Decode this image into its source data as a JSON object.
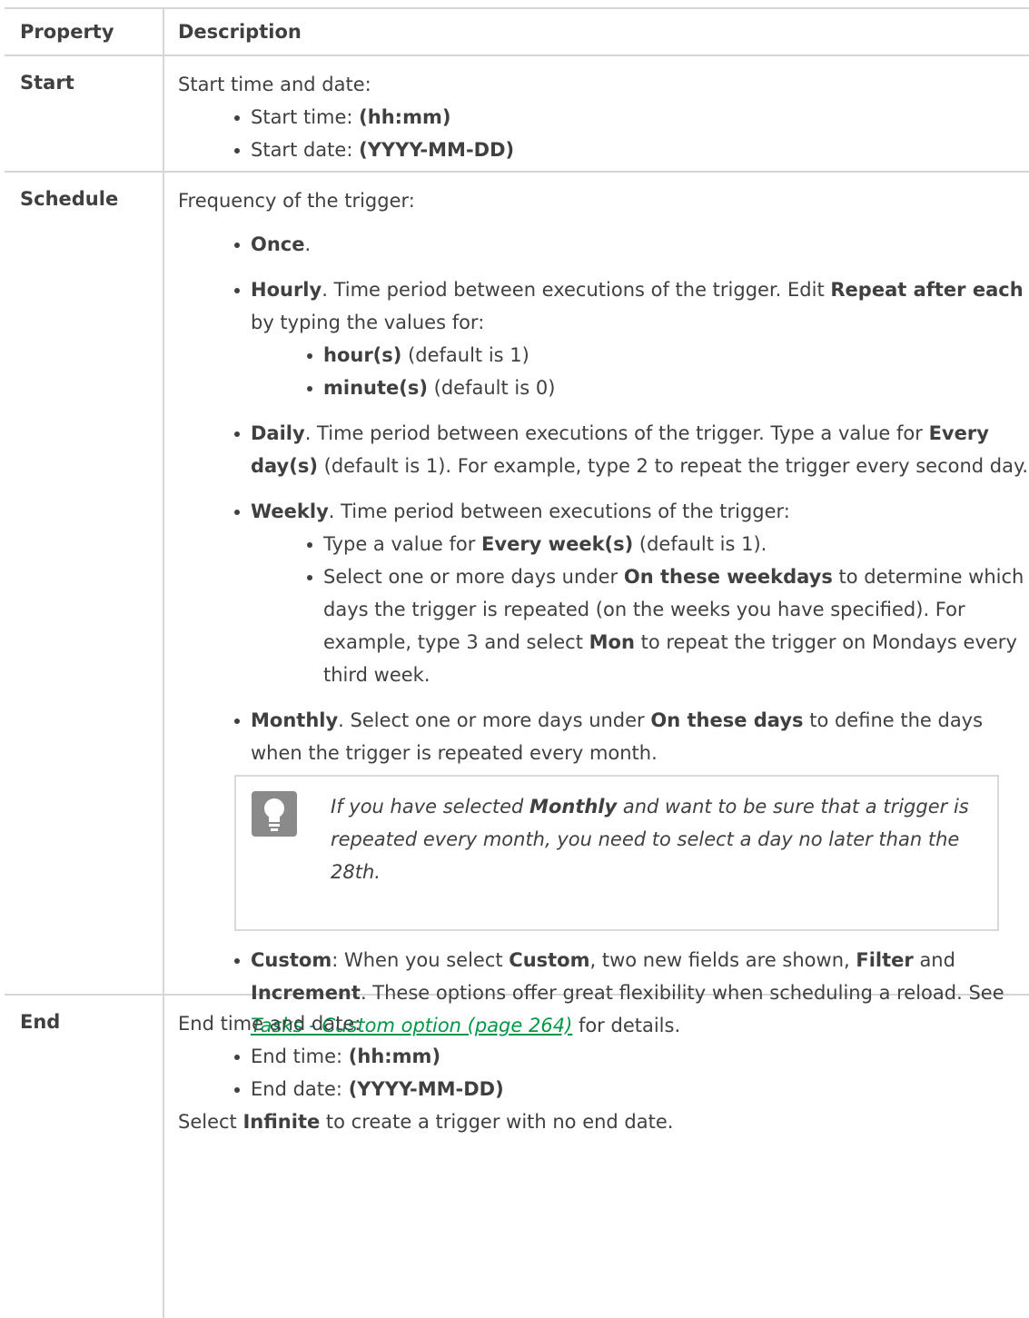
{
  "header": {
    "col1": "Property",
    "col2": "Description"
  },
  "start": {
    "name": "Start",
    "intro": "Start time and date:",
    "items": [
      {
        "label": "Start time: ",
        "value": "(hh:mm)"
      },
      {
        "label": "Start date: ",
        "value": "(YYYY-MM-DD)"
      }
    ]
  },
  "schedule": {
    "name": "Schedule",
    "intro": "Frequency of the trigger:",
    "once": {
      "title": "Once",
      "suffix": "."
    },
    "hourly": {
      "title": "Hourly",
      "text1": ". Time period between executions of the trigger. Edit ",
      "bold1": "Repeat after each",
      "text2": " by typing the values for:",
      "sub": [
        {
          "bold": "hour(s)",
          "text": " (default is 1)"
        },
        {
          "bold": "minute(s)",
          "text": " (default is 0)"
        }
      ]
    },
    "daily": {
      "title": "Daily",
      "text1": ". Time period between executions of the trigger. Type a value for ",
      "bold1": "Every day(s)",
      "text2": " (default is 1). For example, type 2 to repeat the trigger every second day."
    },
    "weekly": {
      "title": "Weekly",
      "text1": ". Time period between executions of the trigger:",
      "sub1": {
        "text1": "Type a value for ",
        "bold": "Every week(s)",
        "text2": " (default is 1)."
      },
      "sub2": {
        "text1": "Select one or more days under ",
        "bold1": "On these weekdays",
        "text2": " to determine which days the trigger is repeated (on the weeks you have specified). For example, type 3 and select ",
        "bold2": "Mon",
        "text3": " to repeat the trigger on Mondays every third week."
      }
    },
    "monthly": {
      "title": "Monthly",
      "text1": ". Select one or more days under ",
      "bold1": "On these days",
      "text2": " to define the days when the trigger is repeated every month."
    },
    "tip": {
      "text1": "If you have selected ",
      "bold": "Monthly",
      "text2": " and want to be sure that a trigger is repeated every month, you need to select a day no later than the 28th."
    },
    "custom": {
      "title": "Custom",
      "text1": ": When you select ",
      "bold1": "Custom",
      "text2": ", two new fields are shown, ",
      "bold2": "Filter",
      "text3": " and ",
      "bold3": "Increment",
      "text4": ". These options offer great flexibility when scheduling a reload. See ",
      "link": "Tasks - Custom option (page 264)",
      "text5": " for details."
    }
  },
  "end": {
    "name": "End",
    "intro": "End time and date:",
    "items": [
      {
        "label": "End time: ",
        "value": "(hh:mm)"
      },
      {
        "label": "End date: ",
        "value": "(YYYY-MM-DD)"
      }
    ],
    "outro1": "Select ",
    "outroBold": "Infinite",
    "outro2": " to create a trigger with no end date."
  },
  "icons": {
    "tip": "lightbulb-icon"
  }
}
